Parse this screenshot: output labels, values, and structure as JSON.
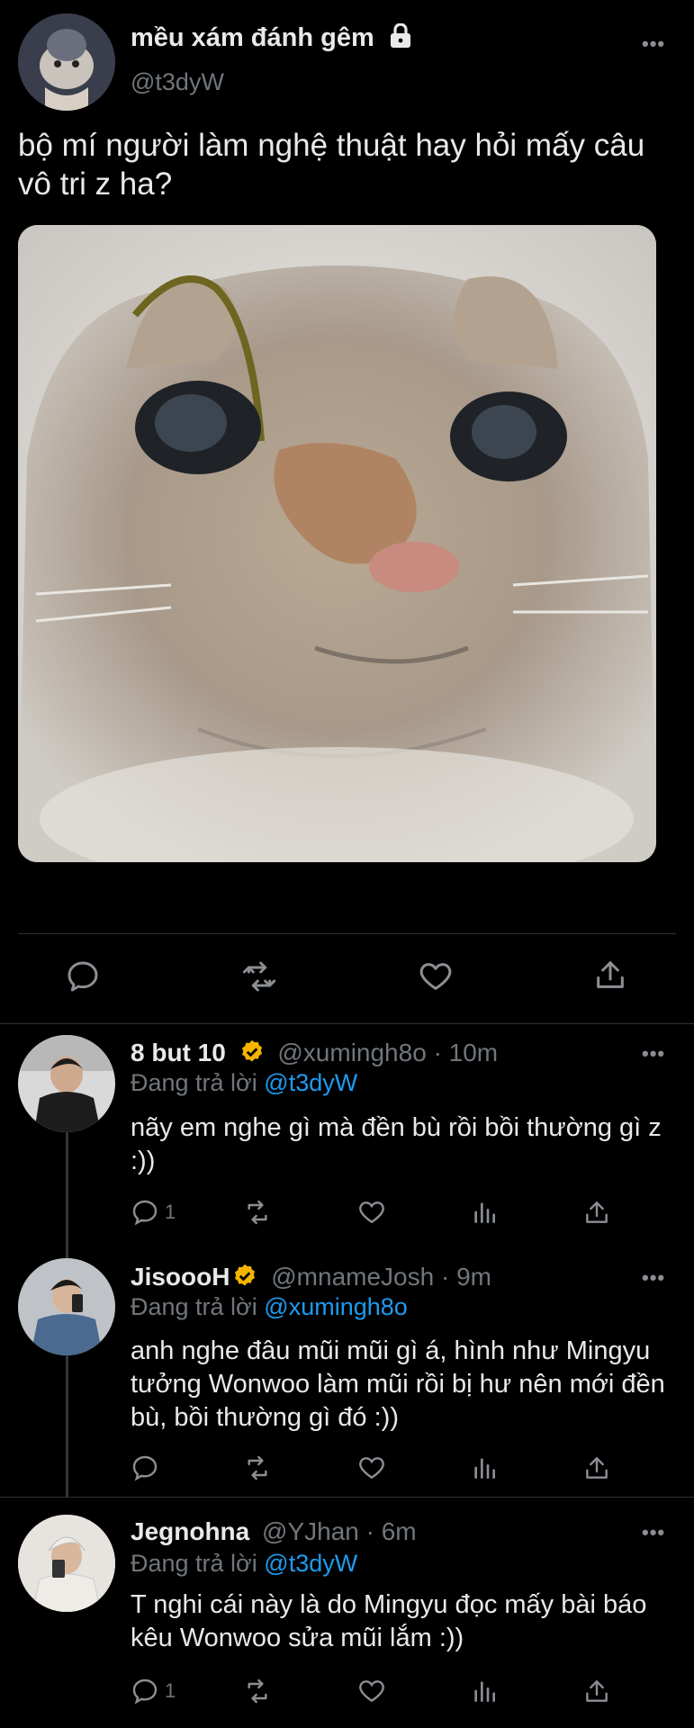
{
  "post": {
    "display_name": "mều xám đánh gêm",
    "handle": "@t3dyW",
    "text": "bộ mí người làm nghệ thuật hay hỏi mấy câu vô tri z ha?",
    "more": "•••"
  },
  "replies": [
    {
      "display_name": "8 but 10",
      "handle": "@xumingh8o",
      "time": "· 10m",
      "replying_prefix": "Đang trả lời",
      "replying_to": "@t3dyW",
      "text": "nãy em nghe gì mà đền bù rồi bồi thường gì z :))",
      "reply_count": "1",
      "more": "•••"
    },
    {
      "display_name": "JisoooH",
      "handle": "@mnameJosh",
      "time": "· 9m",
      "replying_prefix": "Đang trả lời",
      "replying_to": "@xumingh8o",
      "text": "anh nghe đâu mũi mũi gì á, hình như Mingyu tưởng Wonwoo làm mũi rồi bị hư nên mới đền bù, bồi thường gì đó :))",
      "reply_count": "",
      "more": "•••"
    },
    {
      "display_name": "Jegnohna",
      "handle": "@YJhan",
      "time": "· 6m",
      "replying_prefix": "Đang trả lời",
      "replying_to": "@t3dyW",
      "text": "T nghi cái này là do Mingyu đọc mấy bài báo kêu Wonwoo sửa mũi lắm :))",
      "reply_count": "1",
      "more": "•••"
    }
  ],
  "colors": {
    "background": "#000000",
    "text": "#e7e9ea",
    "muted": "#71767b",
    "link": "#1d9bf0",
    "verified": "#f4b400"
  }
}
